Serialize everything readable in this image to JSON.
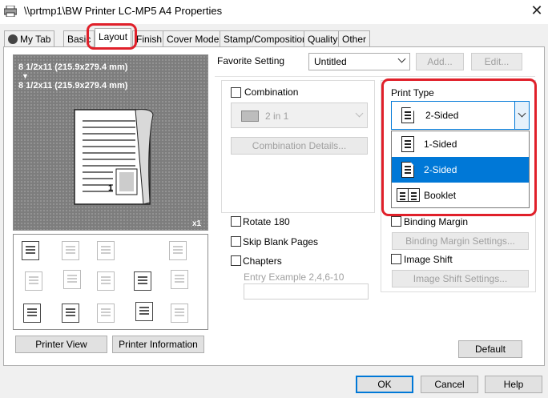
{
  "window": {
    "title": "\\\\prtmp1\\BW Printer LC-MP5 A4 Properties",
    "close_glyph": "✕",
    "icon": "printer-icon"
  },
  "tabs": [
    {
      "label": "My Tab"
    },
    {
      "label": "Basic"
    },
    {
      "label": "Layout",
      "active": true
    },
    {
      "label": "Finish"
    },
    {
      "label": "Cover Mode"
    },
    {
      "label": "Stamp/Composition"
    },
    {
      "label": "Quality"
    },
    {
      "label": "Other"
    }
  ],
  "preview": {
    "size_line1": "8 1/2x11 (215.9x279.4 mm)",
    "arrow": "▼",
    "size_line2": "8 1/2x11 (215.9x279.4 mm)",
    "page_number": "1",
    "copies": "x1"
  },
  "left_buttons": {
    "printer_view": "Printer View",
    "printer_information": "Printer Information"
  },
  "favorite": {
    "label": "Favorite Setting",
    "value": "Untitled",
    "add": "Add...",
    "edit": "Edit..."
  },
  "combination": {
    "label": "Combination",
    "value": "2 in 1",
    "details": "Combination Details..."
  },
  "options": {
    "rotate_180": "Rotate 180",
    "skip_blank": "Skip Blank Pages",
    "chapters": "Chapters",
    "entry_example": "Entry Example 2,4,6-10"
  },
  "print_type": {
    "label": "Print Type",
    "value": "2-Sided",
    "items": [
      {
        "label": "1-Sided",
        "icon": "single-sided-page-icon"
      },
      {
        "label": "2-Sided",
        "icon": "double-sided-page-icon",
        "selected": true
      },
      {
        "label": "Booklet",
        "icon": "booklet-icon"
      }
    ]
  },
  "binding": {
    "label": "Binding Margin",
    "settings": "Binding Margin Settings..."
  },
  "image_shift": {
    "label": "Image Shift",
    "settings": "Image Shift Settings..."
  },
  "default_button": "Default",
  "footer": {
    "ok": "OK",
    "cancel": "Cancel",
    "help": "Help"
  },
  "colors": {
    "highlight": "#e0202a",
    "selection": "#0078d7"
  }
}
